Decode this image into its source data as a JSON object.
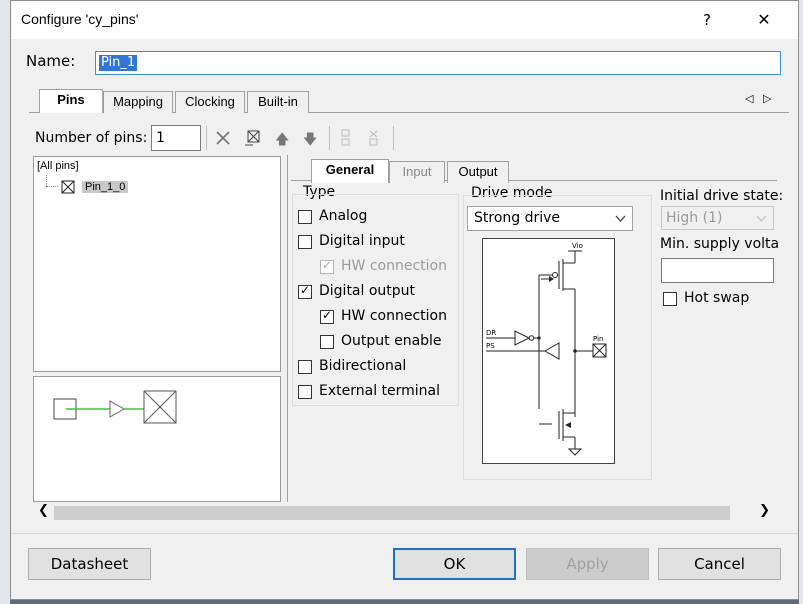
{
  "window": {
    "title": "Configure 'cy_pins'",
    "help_glyph": "?",
    "close_glyph": "✕"
  },
  "name": {
    "label": "Name:",
    "value": "Pin_1"
  },
  "outer_tabs": [
    "Pins",
    "Mapping",
    "Clocking",
    "Built-in"
  ],
  "tab_scroll": {
    "left": "◁",
    "right": "▷"
  },
  "toolbar": {
    "label": "Number of pins:",
    "value": "1"
  },
  "tree": {
    "root": "[All pins]",
    "pin": "Pin_1_0"
  },
  "inner_tabs": [
    "General",
    "Input",
    "Output"
  ],
  "type": {
    "title": "Type",
    "items": [
      {
        "label": "Analog",
        "checked": false,
        "disabled": false
      },
      {
        "label": "Digital input",
        "checked": false,
        "disabled": false
      },
      {
        "label": "HW connection",
        "checked": true,
        "disabled": true
      },
      {
        "label": "Digital output",
        "checked": true,
        "disabled": false
      },
      {
        "label": "HW connection",
        "checked": true,
        "disabled": false
      },
      {
        "label": "Output enable",
        "checked": false,
        "disabled": false
      },
      {
        "label": "Bidirectional",
        "checked": false,
        "disabled": false
      },
      {
        "label": "External terminal",
        "checked": false,
        "disabled": false
      }
    ]
  },
  "drive": {
    "title": "Drive mode",
    "selected": "Strong drive",
    "diagram": {
      "vio": "Vio",
      "dr": "DR",
      "ps": "PS",
      "pin": "Pin"
    }
  },
  "initial": {
    "title": "Initial drive state:",
    "selected": "High (1)"
  },
  "supply": {
    "title": "Min. supply volta",
    "value": ""
  },
  "hot_swap": {
    "label": "Hot swap",
    "checked": false
  },
  "buttons": {
    "datasheet": "Datasheet",
    "ok": "OK",
    "apply": "Apply",
    "cancel": "Cancel"
  },
  "colors": {
    "accent": "#1f6fd1",
    "selection": "#3176d6",
    "wire": "#3cc83c"
  }
}
